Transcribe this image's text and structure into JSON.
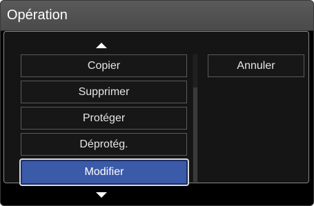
{
  "dialog": {
    "title": "Opération"
  },
  "menu": {
    "items": [
      {
        "label": "Copier"
      },
      {
        "label": "Supprimer"
      },
      {
        "label": "Protéger"
      },
      {
        "label": "Déprotég."
      },
      {
        "label": "Modifier"
      }
    ],
    "selected_label": "Modifier"
  },
  "buttons": {
    "cancel_label": "Annuler"
  },
  "icons": {
    "up": "triangle-up-icon",
    "down": "triangle-down-icon"
  },
  "colors": {
    "selected_bg": "#3b5aa8",
    "item_border": "#5b5b5b",
    "title_bg": "#4a4a4a",
    "panel_bg": "#151515"
  }
}
